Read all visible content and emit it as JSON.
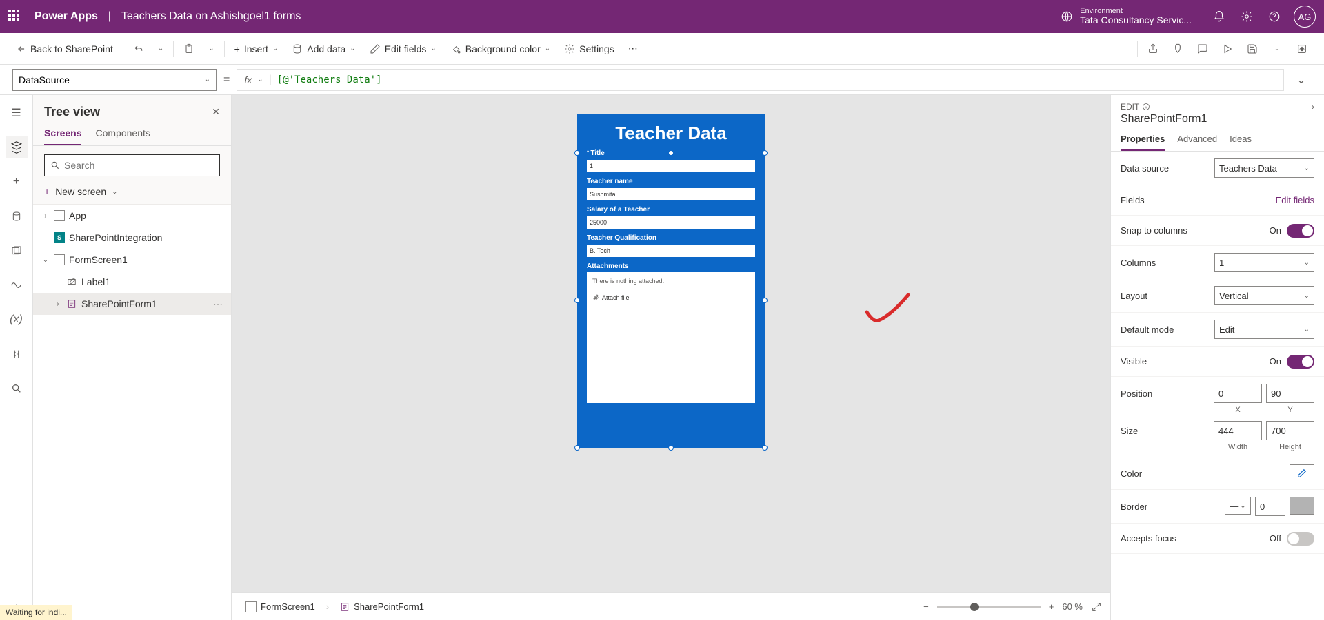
{
  "header": {
    "app": "Power Apps",
    "sep": "|",
    "page": "Teachers Data on Ashishgoel1 forms",
    "env_label": "Environment",
    "env_value": "Tata Consultancy Servic...",
    "avatar": "AG"
  },
  "cmd": {
    "back": "Back to SharePoint",
    "insert": "Insert",
    "add_data": "Add data",
    "edit_fields": "Edit fields",
    "bg_color": "Background color",
    "settings": "Settings"
  },
  "formula": {
    "property": "DataSource",
    "fx": "fx",
    "value": "[@'Teachers Data']"
  },
  "tree": {
    "title": "Tree view",
    "tab_screens": "Screens",
    "tab_components": "Components",
    "search_ph": "Search",
    "new_screen": "New screen",
    "app": "App",
    "sp_integration": "SharePointIntegration",
    "form_screen": "FormScreen1",
    "label1": "Label1",
    "sp_form": "SharePointForm1"
  },
  "canvas": {
    "form_title": "Teacher Data",
    "fields": {
      "title_label": "Title",
      "title_value": "1",
      "name_label": "Teacher name",
      "name_value": "Sushmita",
      "salary_label": "Salary of a Teacher",
      "salary_value": "25000",
      "qual_label": "Teacher Qualification",
      "qual_value": "B. Tech",
      "attach_label": "Attachments",
      "attach_empty": "There is nothing attached.",
      "attach_file": "Attach file"
    }
  },
  "breadcrumb": {
    "screen": "FormScreen1",
    "form": "SharePointForm1",
    "zoom": "60 %"
  },
  "props": {
    "edit": "EDIT",
    "selected": "SharePointForm1",
    "tab_properties": "Properties",
    "tab_advanced": "Advanced",
    "tab_ideas": "Ideas",
    "data_source_label": "Data source",
    "data_source_value": "Teachers Data",
    "fields_label": "Fields",
    "edit_fields": "Edit fields",
    "snap_label": "Snap to columns",
    "on": "On",
    "off": "Off",
    "columns_label": "Columns",
    "columns_value": "1",
    "layout_label": "Layout",
    "layout_value": "Vertical",
    "default_mode_label": "Default mode",
    "default_mode_value": "Edit",
    "visible_label": "Visible",
    "position_label": "Position",
    "pos_x": "0",
    "pos_y": "90",
    "x": "X",
    "y": "Y",
    "size_label": "Size",
    "width_val": "444",
    "height_val": "700",
    "width": "Width",
    "height": "Height",
    "color_label": "Color",
    "border_label": "Border",
    "border_val": "0",
    "accepts_focus_label": "Accepts focus"
  },
  "status": "Waiting for indi..."
}
